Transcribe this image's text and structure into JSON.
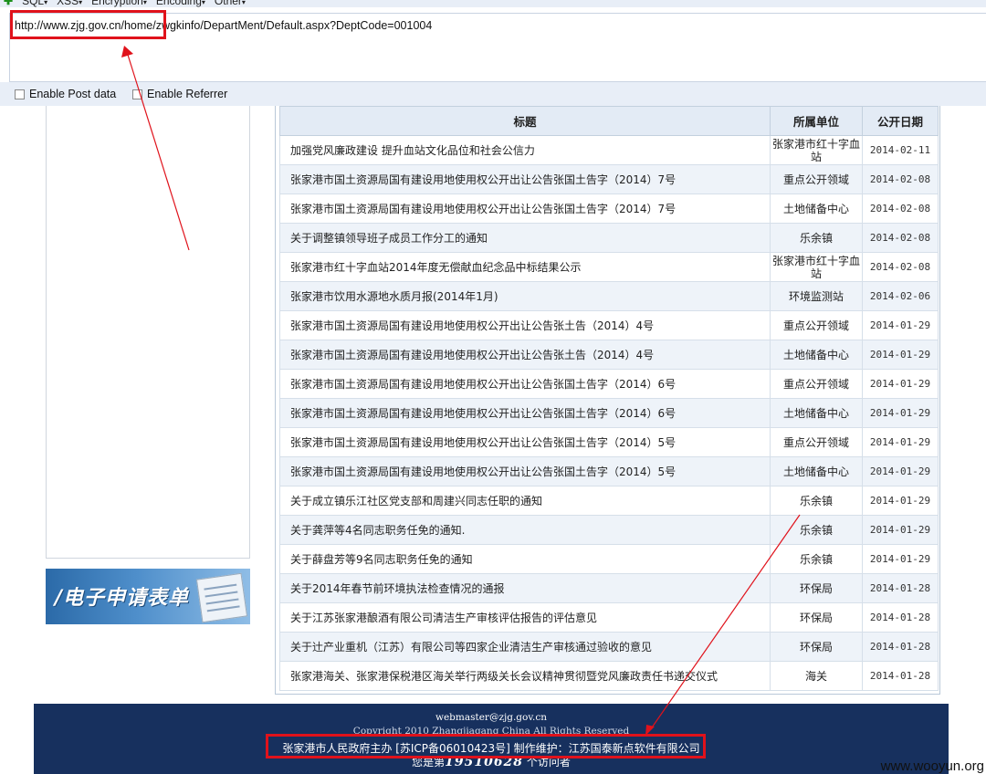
{
  "hackbar": {
    "menu": [
      "SQL",
      "XSS",
      "Encryption",
      "Encoding",
      "Other"
    ],
    "url": "http://www.zjg.gov.cn/home/zwgkinfo/DepartMent/Default.aspx?DeptCode=001004",
    "enable_post": "Enable Post data",
    "enable_referrer": "Enable Referrer"
  },
  "left": {
    "banner_text": "/电子申请表单"
  },
  "table": {
    "headers": [
      "标题",
      "所属单位",
      "公开日期"
    ],
    "rows": [
      {
        "title": "加强党风廉政建设 提升血站文化品位和社会公信力",
        "unit": "张家港市红十字血站",
        "date": "2014-02-11"
      },
      {
        "title": "张家港市国土资源局国有建设用地使用权公开出让公告张国土告字（2014）7号",
        "unit": "重点公开领域",
        "date": "2014-02-08"
      },
      {
        "title": "张家港市国土资源局国有建设用地使用权公开出让公告张国土告字（2014）7号",
        "unit": "土地储备中心",
        "date": "2014-02-08"
      },
      {
        "title": "关于调整镇领导班子成员工作分工的通知",
        "unit": "乐余镇",
        "date": "2014-02-08"
      },
      {
        "title": "张家港市红十字血站2014年度无偿献血纪念品中标结果公示",
        "unit": "张家港市红十字血站",
        "date": "2014-02-08"
      },
      {
        "title": "张家港市饮用水源地水质月报(2014年1月)",
        "unit": "环境监测站",
        "date": "2014-02-06"
      },
      {
        "title": "张家港市国土资源局国有建设用地使用权公开出让公告张土告（2014）4号",
        "unit": "重点公开领域",
        "date": "2014-01-29"
      },
      {
        "title": "张家港市国土资源局国有建设用地使用权公开出让公告张土告（2014）4号",
        "unit": "土地储备中心",
        "date": "2014-01-29"
      },
      {
        "title": "张家港市国土资源局国有建设用地使用权公开出让公告张国土告字（2014）6号",
        "unit": "重点公开领域",
        "date": "2014-01-29"
      },
      {
        "title": "张家港市国土资源局国有建设用地使用权公开出让公告张国土告字（2014）6号",
        "unit": "土地储备中心",
        "date": "2014-01-29"
      },
      {
        "title": "张家港市国土资源局国有建设用地使用权公开出让公告张国土告字（2014）5号",
        "unit": "重点公开领域",
        "date": "2014-01-29"
      },
      {
        "title": "张家港市国土资源局国有建设用地使用权公开出让公告张国土告字（2014）5号",
        "unit": "土地储备中心",
        "date": "2014-01-29"
      },
      {
        "title": "关于成立镇乐江社区党支部和周建兴同志任职的通知",
        "unit": "乐余镇",
        "date": "2014-01-29"
      },
      {
        "title": "关于龚萍等4名同志职务任免的通知.",
        "unit": "乐余镇",
        "date": "2014-01-29"
      },
      {
        "title": "关于薛盘芳等9名同志职务任免的通知",
        "unit": "乐余镇",
        "date": "2014-01-29"
      },
      {
        "title": "关于2014年春节前环境执法检查情况的通报",
        "unit": "环保局",
        "date": "2014-01-28"
      },
      {
        "title": "关于江苏张家港酿酒有限公司清洁生产审核评估报告的评估意见",
        "unit": "环保局",
        "date": "2014-01-28"
      },
      {
        "title": "关于辻产业重机（江苏）有限公司等四家企业清洁生产审核通过验收的意见",
        "unit": "环保局",
        "date": "2014-01-28"
      },
      {
        "title": "张家港海关、张家港保税港区海关举行两级关长会议精神贯彻暨党风廉政责任书递交仪式",
        "unit": "海关",
        "date": "2014-01-28"
      }
    ]
  },
  "footer": {
    "email": "webmaster@zjg.gov.cn",
    "copyright": "Copyright 2010 Zhangjiagang China All Rights Reserved",
    "icp": "张家港市人民政府主办 [苏ICP备06010423号] 制作维护：江苏国泰新点软件有限公司",
    "visits_prefix": "您是第",
    "visits_count": "19510628",
    "visits_suffix": "个访问者"
  },
  "watermark": "www.wooyun.org",
  "colors": {
    "annotation_red": "#e0121b",
    "footer_bg": "#17305e",
    "hackbar_bg": "#e8eef7"
  }
}
